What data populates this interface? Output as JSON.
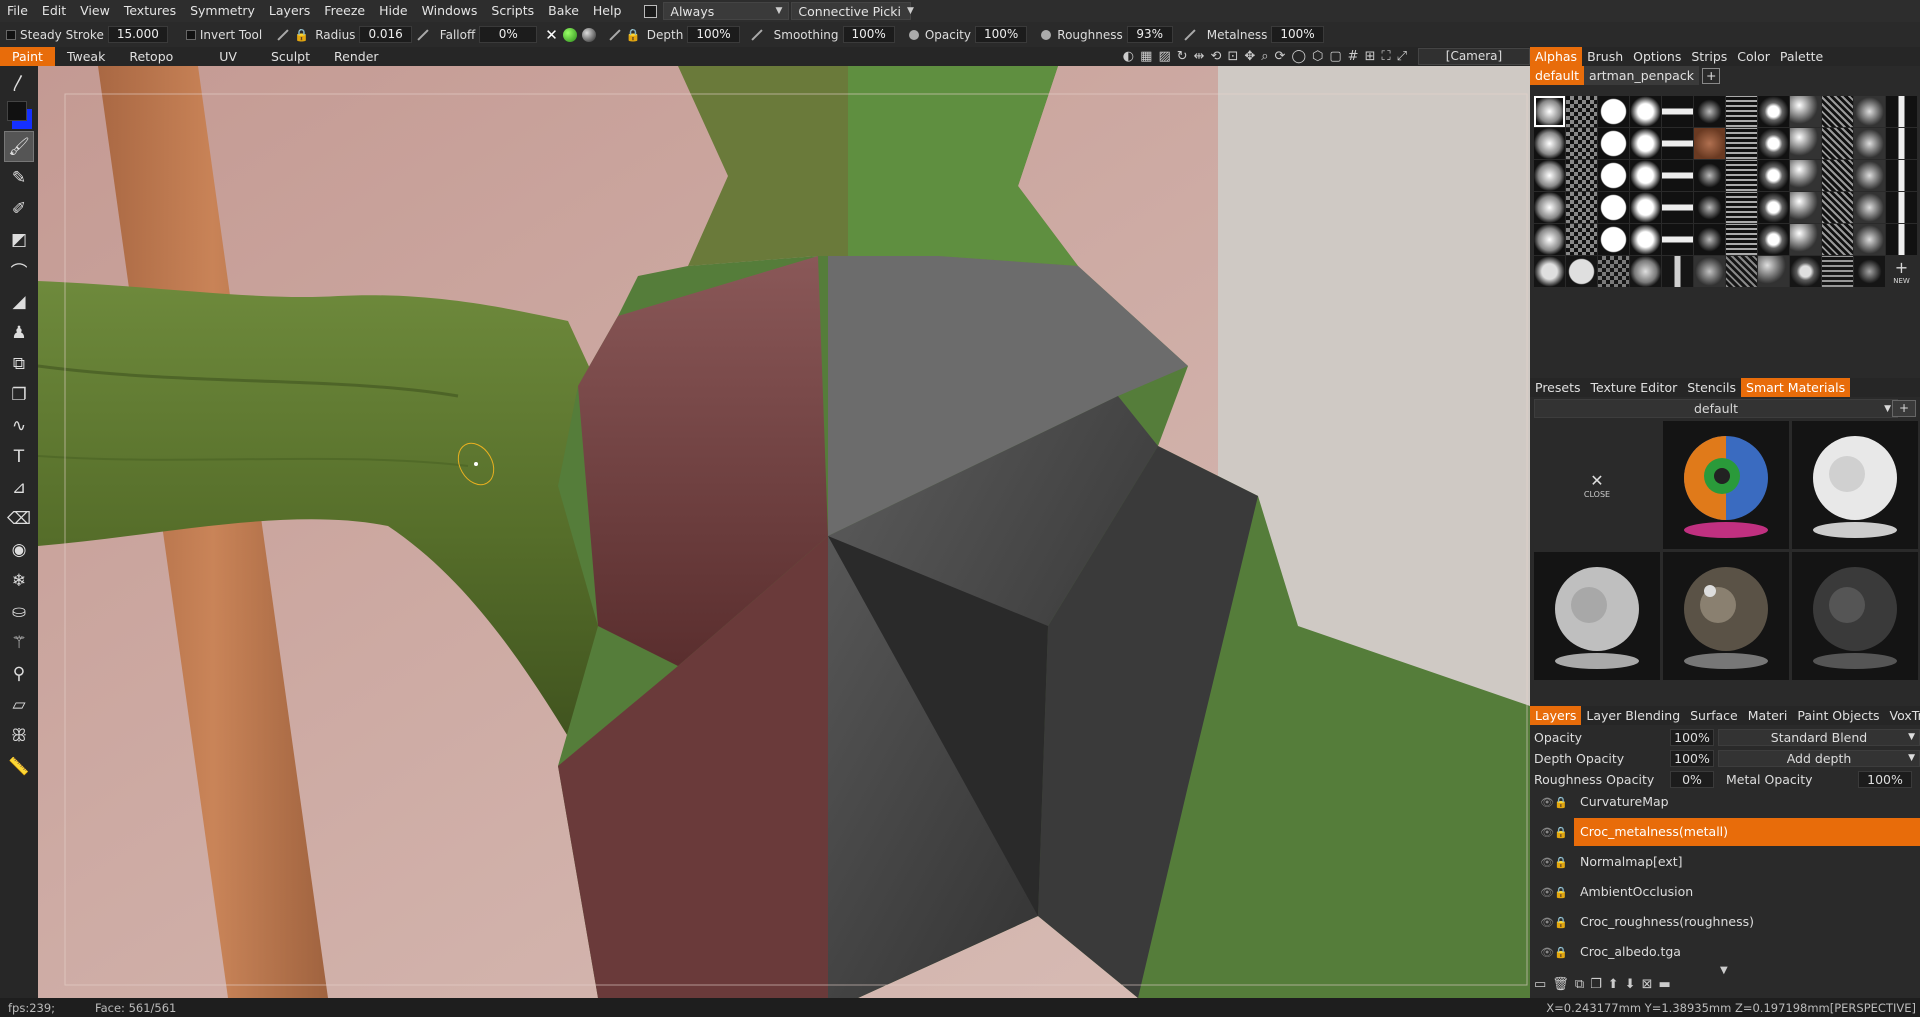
{
  "menubar": {
    "items": [
      "File",
      "Edit",
      "View",
      "Textures",
      "Symmetry",
      "Layers",
      "Freeze",
      "Hide",
      "Windows",
      "Scripts",
      "Bake",
      "Help"
    ],
    "always_dropdown": "Always",
    "picking_dropdown": "Connective  Picki"
  },
  "toolbar": {
    "steady_stroke_label": "Steady  Stroke",
    "steady_stroke_value": "15.000",
    "invert_tool_label": "Invert  Tool",
    "radius_label": "Radius",
    "radius_value": "0.016",
    "falloff_label": "Falloff",
    "falloff_value": "0%",
    "depth_label": "Depth",
    "depth_value": "100%",
    "smoothing_label": "Smoothing",
    "smoothing_value": "100%",
    "opacity_label": "Opacity",
    "opacity_value": "100%",
    "roughness_label": "Roughness",
    "roughness_value": "93%",
    "metalness_label": "Metalness",
    "metalness_value": "100%"
  },
  "rooms": {
    "tabs": [
      "Paint",
      "Tweak",
      "Retopo",
      "UV",
      "Sculpt",
      "Render"
    ],
    "active": "Paint",
    "camera": "[Camera]"
  },
  "alphas_panel": {
    "tabs": [
      "Alphas",
      "Brush",
      "Options",
      "Strips",
      "Color",
      "Palette"
    ],
    "active_tab": "Alphas",
    "packs": [
      "default",
      "artman_penpack"
    ],
    "new_label": "NEW"
  },
  "smart_materials": {
    "tabs": [
      "Presets",
      "Texture Editor",
      "Stencils",
      "Smart  Materials"
    ],
    "active_tab": "Smart  Materials",
    "folder": "default",
    "close_label": "CLOSE"
  },
  "layers_panel": {
    "tabs": [
      "Layers",
      "Layer  Blending",
      "Surface",
      "Materi",
      "Paint  Objects",
      "VoxTree"
    ],
    "active_tab": "Layers",
    "opacity_label": "Opacity",
    "opacity_value": "100%",
    "blend_mode": "Standard  Blend",
    "depth_opacity_label": "Depth  Opacity",
    "depth_opacity_value": "100%",
    "depth_mode": "Add  depth",
    "roughness_opacity_label": "Roughness  Opacity",
    "roughness_opacity_value": "0%",
    "metal_opacity_label": "Metal  Opacity",
    "metal_opacity_value": "100%",
    "layers": [
      "CurvatureMap",
      "Croc_metalness(metall)",
      "Normalmap[ext]",
      "AmbientOcclusion",
      "Croc_roughness(roughness)",
      "Croc_albedo.tga"
    ],
    "selected": "Croc_metalness(metall)"
  },
  "status": {
    "fps": "fps:239;",
    "face": "Face:  561/561",
    "coords": "X=0.243177mm  Y=1.38935mm  Z=0.197198mm[PERSPECTIVE]"
  },
  "colors": {
    "accent": "#e86c0a",
    "primary_swatch": "#111111",
    "secondary_swatch": "#1530ff"
  }
}
